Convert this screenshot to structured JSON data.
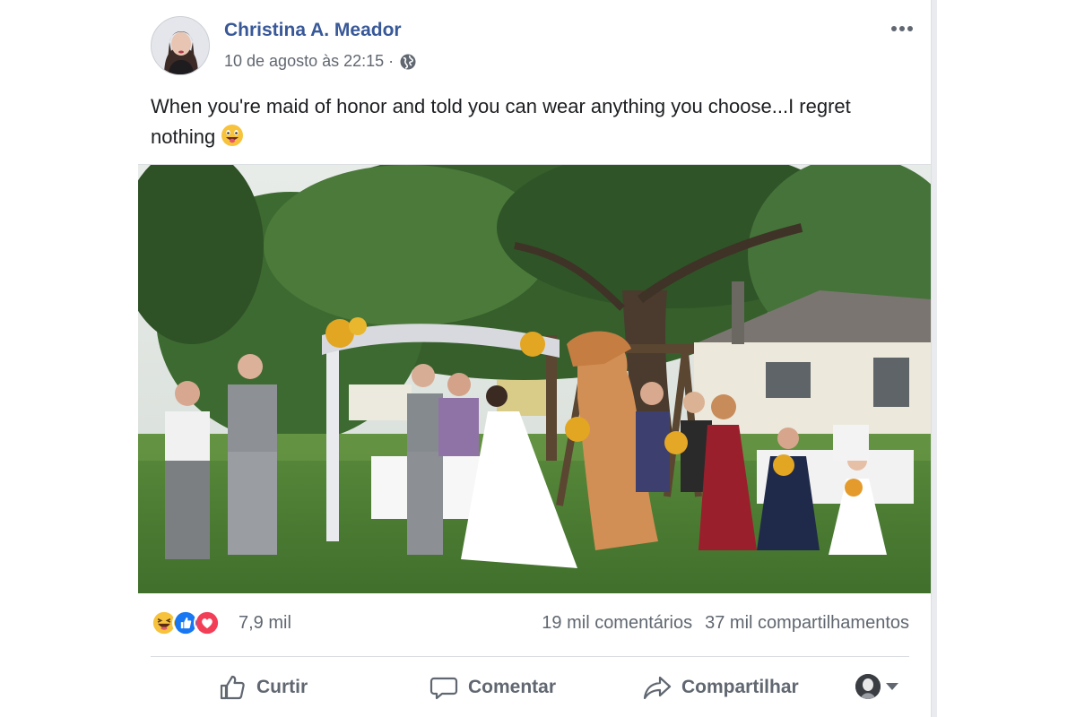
{
  "post": {
    "author": "Christina A. Meador",
    "timestamp": "10 de agosto às 22:15 ·",
    "privacy_icon": "globe-icon",
    "text": "When you're maid of honor and told you can wear anything you choose...I regret nothing",
    "text_emoji": "grinning-tongue-emoji",
    "photo_icon": "wedding-photo-trex-costume"
  },
  "stats": {
    "reactions": [
      "haha-reaction-icon",
      "like-reaction-icon",
      "love-reaction-icon"
    ],
    "reaction_count": "7,9 mil",
    "comments": "19 mil comentários",
    "shares": "37 mil compartilhamentos"
  },
  "actions": {
    "like": "Curtir",
    "comment": "Comentar",
    "share": "Compartilhar"
  },
  "colors": {
    "author": "#385898",
    "meta": "#616770",
    "like_blue": "#1877f2",
    "love_red": "#f33e58",
    "haha_yellow": "#f7c23c"
  }
}
